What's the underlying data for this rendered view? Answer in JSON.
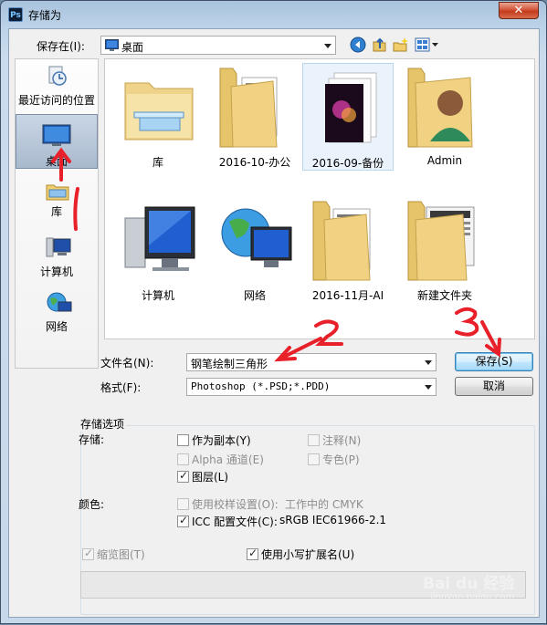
{
  "window": {
    "title": "存储为",
    "app_icon_label": "Ps",
    "close_label": "✕"
  },
  "top": {
    "save_in_label": "保存在(I):",
    "save_in_value": "桌面",
    "toolbar_icons": [
      "back-icon",
      "up-folder-icon",
      "new-folder-icon",
      "view-menu-icon"
    ]
  },
  "places": [
    {
      "label": "最近访问的位置",
      "icon": "recent-places-icon"
    },
    {
      "label": "桌面",
      "icon": "desktop-icon",
      "selected": true
    },
    {
      "label": "库",
      "icon": "library-icon"
    },
    {
      "label": "计算机",
      "icon": "computer-icon"
    },
    {
      "label": "网络",
      "icon": "network-icon"
    }
  ],
  "files": [
    {
      "label": "库",
      "icon": "library-folder-icon"
    },
    {
      "label": "2016-10-办公",
      "icon": "folder-icon"
    },
    {
      "label": "2016-09-备份",
      "icon": "document-icon",
      "selected": true
    },
    {
      "label": "Admin",
      "icon": "user-folder-icon"
    },
    {
      "label": "计算机",
      "icon": "computer-icon"
    },
    {
      "label": "网络",
      "icon": "network-globe-icon"
    },
    {
      "label": "2016-11月-AI",
      "icon": "folder-icon"
    },
    {
      "label": "新建文件夹",
      "icon": "folder-icon"
    }
  ],
  "filename": {
    "label": "文件名(N):",
    "value": "钢笔绘制三角形"
  },
  "format": {
    "label": "格式(F):",
    "value": "Photoshop (*.PSD;*.PDD)"
  },
  "buttons": {
    "save": "保存(S)",
    "cancel": "取消"
  },
  "options": {
    "group_title": "存储选项",
    "save_label": "存储:",
    "as_copy": {
      "label": "作为副本(Y)",
      "checked": false,
      "enabled": true
    },
    "notes": {
      "label": "注释(N)",
      "checked": false,
      "enabled": false
    },
    "alpha": {
      "label": "Alpha 通道(E)",
      "checked": false,
      "enabled": false
    },
    "spot": {
      "label": "专色(P)",
      "checked": false,
      "enabled": false
    },
    "layers": {
      "label": "图层(L)",
      "checked": true,
      "enabled": true
    },
    "color_label": "颜色:",
    "proof": {
      "label": "使用校样设置(O):",
      "suffix": "工作中的 CMYK",
      "checked": false,
      "enabled": false
    },
    "icc": {
      "label": "ICC 配置文件(C):",
      "suffix": "sRGB IEC61966-2.1",
      "checked": true,
      "enabled": true
    },
    "thumbnail": {
      "label": "缩览图(T)",
      "checked": true,
      "enabled": false
    },
    "lowercase": {
      "label": "使用小写扩展名(U)",
      "checked": true,
      "enabled": true
    }
  },
  "annotations": {
    "step1": "1",
    "step2": "2",
    "step3": "3",
    "arrow_color": "#e8202a"
  },
  "watermark": {
    "text": "Bai du 经验",
    "sub": "jingyan.baidu.com"
  }
}
